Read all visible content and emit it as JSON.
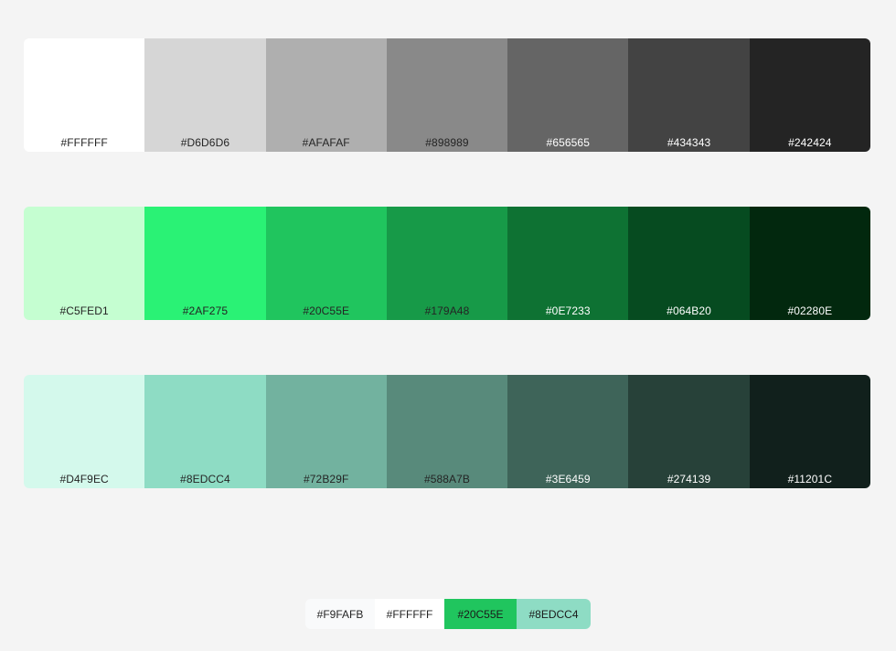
{
  "palettes": {
    "gray": [
      {
        "hex": "#FFFFFF",
        "label": "#FFFFFF",
        "text_color": "#242424"
      },
      {
        "hex": "#D6D6D6",
        "label": "#D6D6D6",
        "text_color": "#242424"
      },
      {
        "hex": "#AFAFAF",
        "label": "#AFAFAF",
        "text_color": "#242424"
      },
      {
        "hex": "#898989",
        "label": "#898989",
        "text_color": "#242424"
      },
      {
        "hex": "#656565",
        "label": "#656565",
        "text_color": "#FFFFFF"
      },
      {
        "hex": "#434343",
        "label": "#434343",
        "text_color": "#FFFFFF"
      },
      {
        "hex": "#242424",
        "label": "#242424",
        "text_color": "#FFFFFF"
      }
    ],
    "green": [
      {
        "hex": "#C5FED1",
        "label": "#C5FED1",
        "text_color": "#242424"
      },
      {
        "hex": "#2AF275",
        "label": "#2AF275",
        "text_color": "#242424"
      },
      {
        "hex": "#20C55E",
        "label": "#20C55E",
        "text_color": "#242424"
      },
      {
        "hex": "#179A48",
        "label": "#179A48",
        "text_color": "#242424"
      },
      {
        "hex": "#0E7233",
        "label": "#0E7233",
        "text_color": "#FFFFFF"
      },
      {
        "hex": "#064B20",
        "label": "#064B20",
        "text_color": "#FFFFFF"
      },
      {
        "hex": "#02280E",
        "label": "#02280E",
        "text_color": "#FFFFFF"
      }
    ],
    "mint": [
      {
        "hex": "#D4F9EC",
        "label": "#D4F9EC",
        "text_color": "#242424"
      },
      {
        "hex": "#8EDCC4",
        "label": "#8EDCC4",
        "text_color": "#242424"
      },
      {
        "hex": "#72B29F",
        "label": "#72B29F",
        "text_color": "#242424"
      },
      {
        "hex": "#588A7B",
        "label": "#588A7B",
        "text_color": "#242424"
      },
      {
        "hex": "#3E6459",
        "label": "#3E6459",
        "text_color": "#FFFFFF"
      },
      {
        "hex": "#274139",
        "label": "#274139",
        "text_color": "#FFFFFF"
      },
      {
        "hex": "#11201C",
        "label": "#11201C",
        "text_color": "#FFFFFF"
      }
    ]
  },
  "legend": [
    {
      "hex": "#F9FAFB",
      "label": "#F9FAFB",
      "text_color": "#242424"
    },
    {
      "hex": "#FFFFFF",
      "label": "#FFFFFF",
      "text_color": "#242424"
    },
    {
      "hex": "#20C55E",
      "label": "#20C55E",
      "text_color": "#1A1A1A"
    },
    {
      "hex": "#8EDCC4",
      "label": "#8EDCC4",
      "text_color": "#1A1A1A"
    }
  ]
}
